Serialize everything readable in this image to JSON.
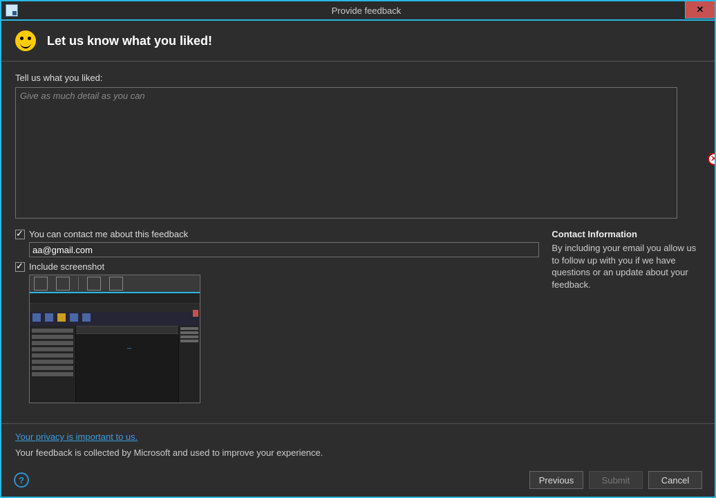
{
  "window": {
    "title": "Provide feedback"
  },
  "header": {
    "title": "Let us know what you liked!"
  },
  "form": {
    "feedback_label": "Tell us what you liked:",
    "feedback_placeholder": "Give as much detail as you can",
    "feedback_value": "",
    "contact_label": "You can contact me about this feedback",
    "email_value": "aa@gmail.com",
    "screenshot_label": "Include screenshot"
  },
  "contact_info": {
    "heading": "Contact Information",
    "text": "By including your email you allow us to follow up with you if we have questions or an update about your feedback."
  },
  "privacy": {
    "link": "Your privacy is important to us.",
    "line": "Your feedback is collected by Microsoft and used to improve your experience."
  },
  "buttons": {
    "previous": "Previous",
    "submit": "Submit",
    "cancel": "Cancel"
  }
}
